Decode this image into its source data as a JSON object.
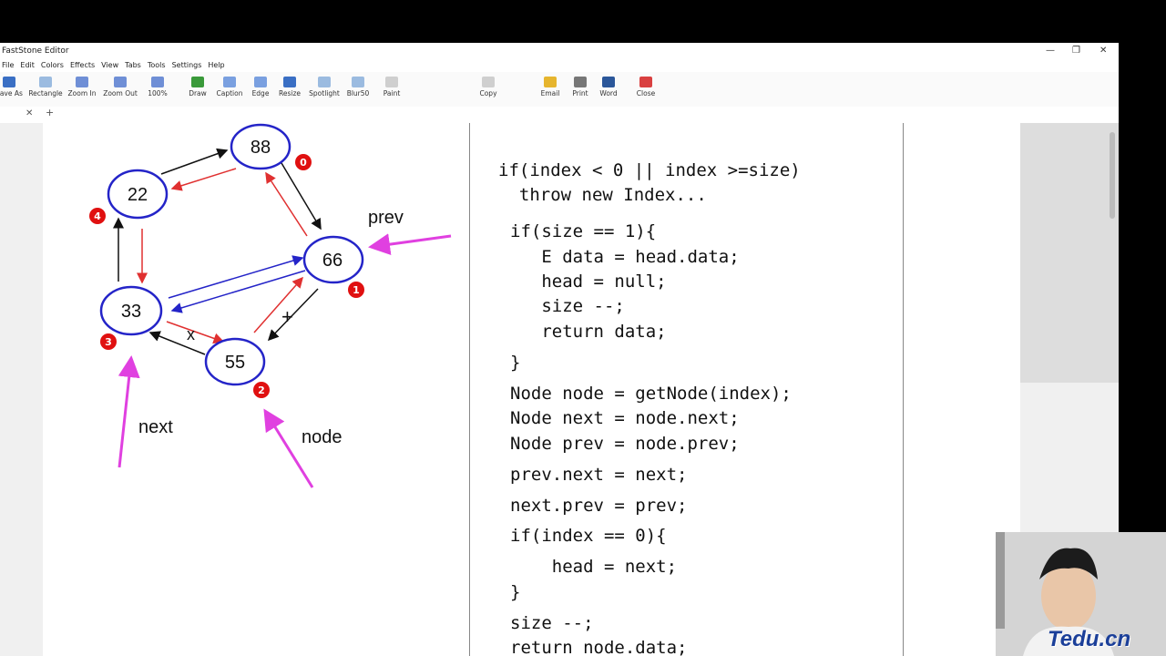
{
  "app": {
    "title": "FastStone Editor",
    "window_controls": {
      "minimize": "—",
      "maximize": "❐",
      "close": "✕"
    }
  },
  "menu": [
    "File",
    "Edit",
    "Colors",
    "Effects",
    "View",
    "Tabs",
    "Tools",
    "Settings",
    "Help"
  ],
  "toolbar": [
    {
      "label": "Save As",
      "icon": "save-icon",
      "color": "#3a6fc4"
    },
    {
      "label": "Rectangle",
      "icon": "rectangle-select-icon",
      "color": "#9bbbe0"
    },
    {
      "label": "Zoom In",
      "icon": "zoom-in-icon",
      "color": "#6f8fd6"
    },
    {
      "label": "Zoom Out",
      "icon": "zoom-out-icon",
      "color": "#6f8fd6"
    },
    {
      "label": "100%",
      "icon": "actual-size-icon",
      "color": "#6f8fd6"
    },
    {
      "label": "Draw",
      "icon": "draw-icon",
      "color": "#3a9a3a"
    },
    {
      "label": "Caption",
      "icon": "caption-icon",
      "color": "#7aa0e0"
    },
    {
      "label": "Edge",
      "icon": "edge-icon",
      "color": "#7aa0e0"
    },
    {
      "label": "Resize",
      "icon": "resize-icon",
      "color": "#3a6fc4"
    },
    {
      "label": "Spotlight",
      "icon": "spotlight-icon",
      "color": "#9bbbe0"
    },
    {
      "label": "Blur50",
      "icon": "blur-icon",
      "color": "#9bbbe0"
    },
    {
      "label": "Paint",
      "icon": "paint-icon",
      "color": "#cfcfcf"
    },
    {
      "label": "Copy",
      "icon": "copy-icon",
      "color": "#cfcfcf"
    },
    {
      "label": "Email",
      "icon": "email-icon",
      "color": "#e6b52e"
    },
    {
      "label": "Print",
      "icon": "print-icon",
      "color": "#777777"
    },
    {
      "label": "Word",
      "icon": "word-icon",
      "color": "#2b579a"
    },
    {
      "label": "Close",
      "icon": "close-icon",
      "color": "#d94040"
    }
  ],
  "tabs": {
    "close": "✕",
    "add": "+"
  },
  "diagram": {
    "nodes": [
      {
        "value": "88",
        "index": "0"
      },
      {
        "value": "22",
        "index": "4"
      },
      {
        "value": "66",
        "index": "1"
      },
      {
        "value": "33",
        "index": "3"
      },
      {
        "value": "55",
        "index": "2"
      }
    ],
    "pointer_labels": {
      "prev": "prev",
      "next": "next",
      "node": "node"
    },
    "colors": {
      "node": "#2424c8",
      "badge": "#e01010",
      "pointer": "#e040e0",
      "red_arrow": "#e03030"
    }
  },
  "code_lines": [
    "if(index < 0 || index >=size)",
    "  throw new Index...",
    "if(size == 1){",
    "   E data = head.data;",
    "   head = null;",
    "   size --;",
    "   return data;",
    "}",
    "Node node = getNode(index);",
    "Node next = node.next;",
    "Node prev = node.prev;",
    "prev.next = next;",
    "next.prev = prev;",
    "if(index == 0){",
    "    head = next;",
    "}",
    "size --;",
    "return node.data;"
  ],
  "watermark": {
    "logo": "Tedu.cn"
  }
}
